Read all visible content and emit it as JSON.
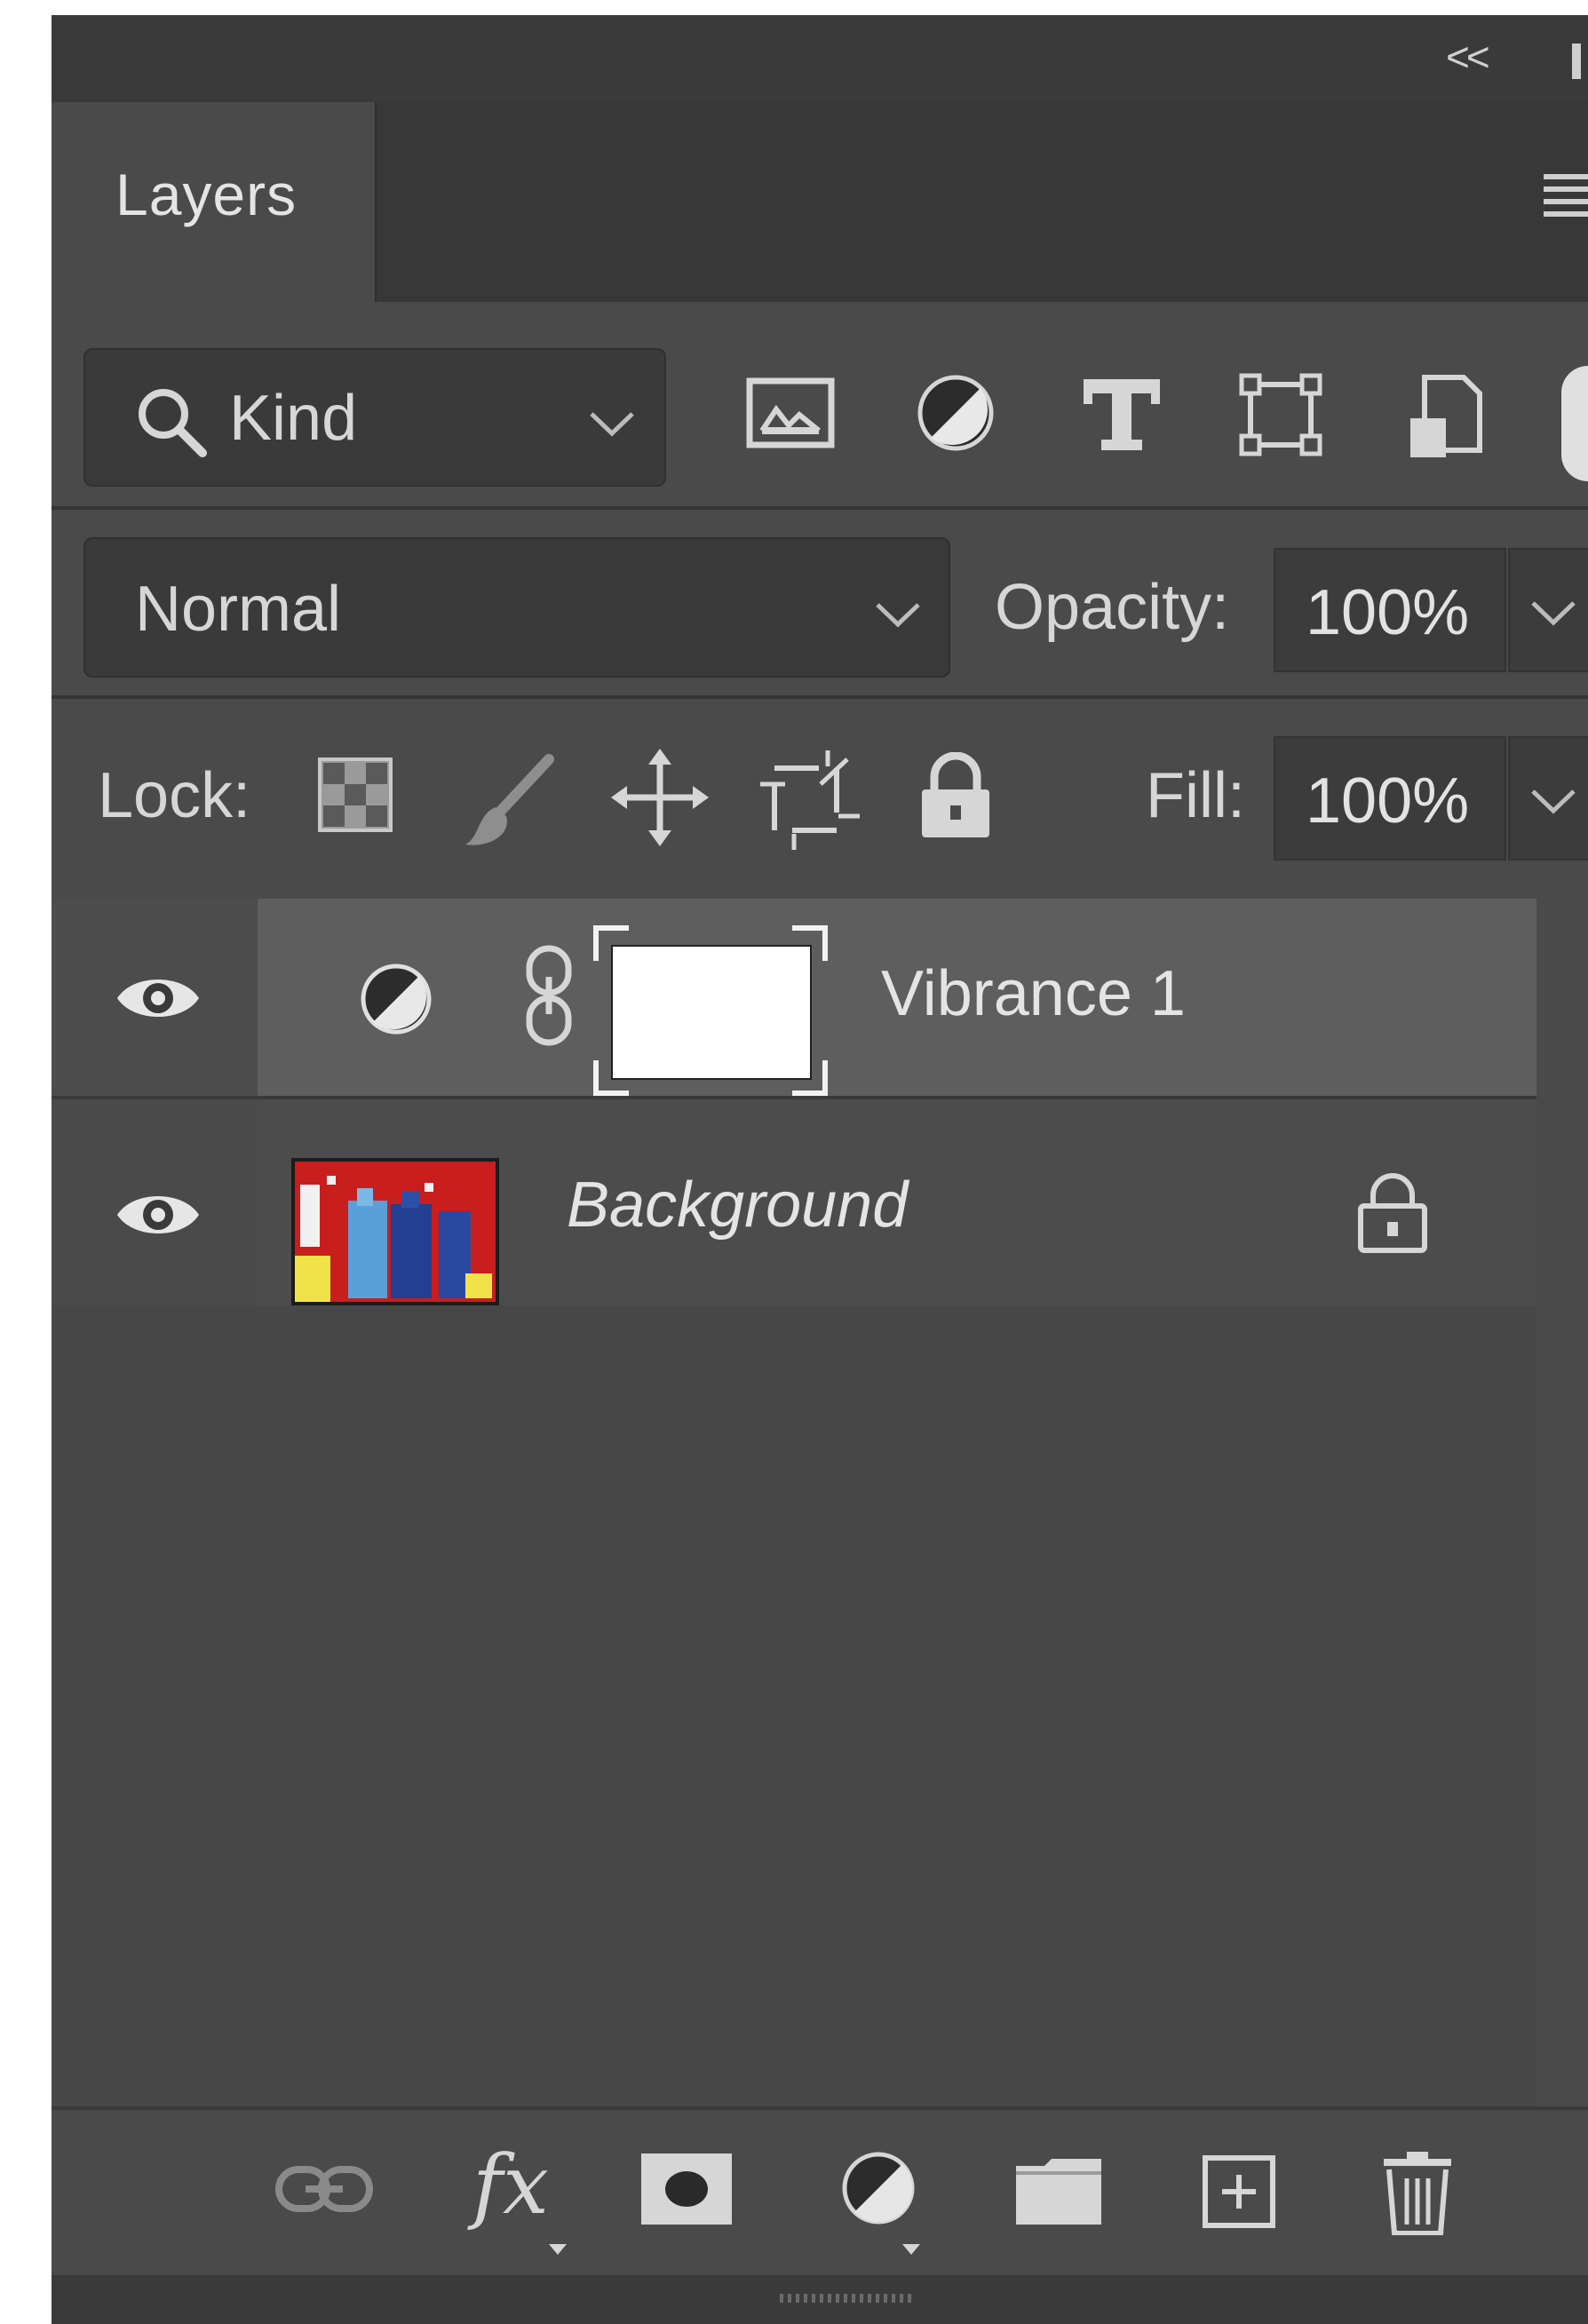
{
  "panel": {
    "tab_label": "Layers",
    "collapse_glyph": "<<",
    "menu_icon": "hamburger-menu-icon"
  },
  "filter": {
    "kind_label": "Kind",
    "icons": [
      "search-icon",
      "image-filter-icon",
      "adjustment-filter-icon",
      "type-filter-icon",
      "shape-filter-icon",
      "smart-object-filter-icon"
    ]
  },
  "blend": {
    "mode_value": "Normal",
    "opacity_label": "Opacity:",
    "opacity_value": "100%"
  },
  "lock": {
    "label": "Lock:",
    "fill_label": "Fill:",
    "fill_value": "100%"
  },
  "layers": [
    {
      "name": "Vibrance 1",
      "type": "adjustment",
      "visible": true,
      "selected": true
    },
    {
      "name": "Background",
      "type": "image",
      "visible": true,
      "locked": true,
      "italic": true
    }
  ],
  "colors": {
    "panel_bg": "#4a4a4a",
    "selected_row": "#5e5e5e",
    "text": "#d6d6d6"
  }
}
